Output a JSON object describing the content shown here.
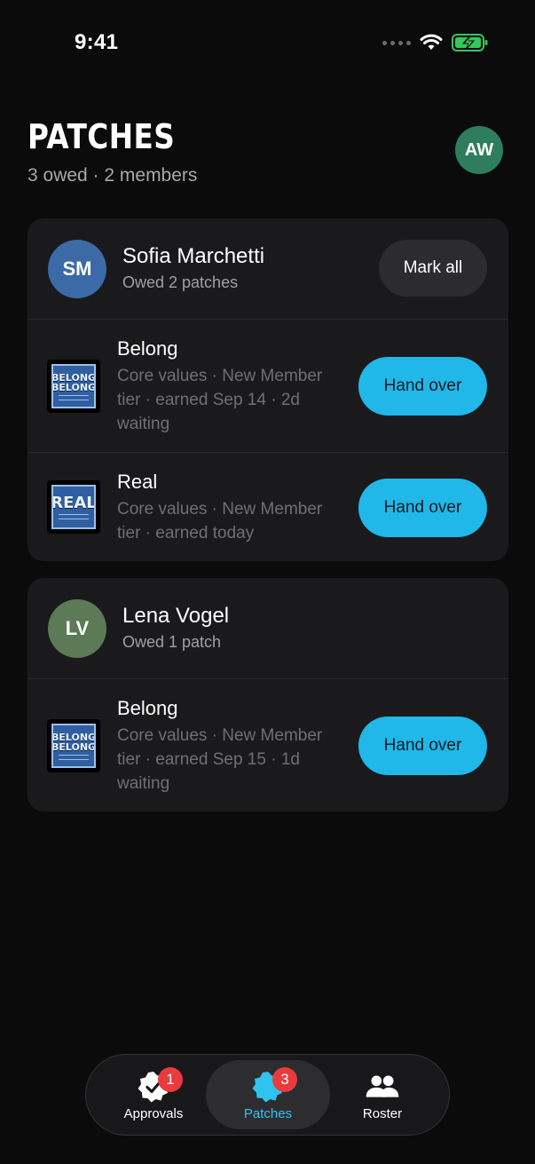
{
  "status_bar": {
    "time": "9:41"
  },
  "header": {
    "title": "PATCHES",
    "subtitle": "3 owed · 2 members",
    "user_initials": "AW"
  },
  "members": [
    {
      "initials": "SM",
      "avatar_color": "#3b6aa6",
      "name": "Sofia Marchetti",
      "owed": "Owed 2 patches",
      "mark_all_label": "Mark all",
      "patches": [
        {
          "name": "Belong",
          "thumb_text": "BELONG",
          "meta": "Core values · New Member tier · earned Sep 14 · 2d waiting",
          "action": "Hand over"
        },
        {
          "name": "Real",
          "thumb_text": "REAL",
          "meta": "Core values · New Member tier · earned today",
          "action": "Hand over"
        }
      ]
    },
    {
      "initials": "LV",
      "avatar_color": "#5b7a55",
      "name": "Lena Vogel",
      "owed": "Owed 1 patch",
      "patches": [
        {
          "name": "Belong",
          "thumb_text": "BELONG",
          "meta": "Core values · New Member tier · earned Sep 15 · 1d waiting",
          "action": "Hand over"
        }
      ]
    }
  ],
  "tab_bar": {
    "tabs": [
      {
        "label": "Approvals",
        "badge": "1",
        "icon": "verified-check-icon"
      },
      {
        "label": "Patches",
        "badge": "3",
        "icon": "patch-badge-icon",
        "active": true
      },
      {
        "label": "Roster",
        "icon": "people-icon"
      }
    ]
  },
  "colors": {
    "accent": "#21b7e8",
    "badge": "#ea3a3e",
    "background": "#0b0b0c",
    "card": "#1a1a1c"
  }
}
